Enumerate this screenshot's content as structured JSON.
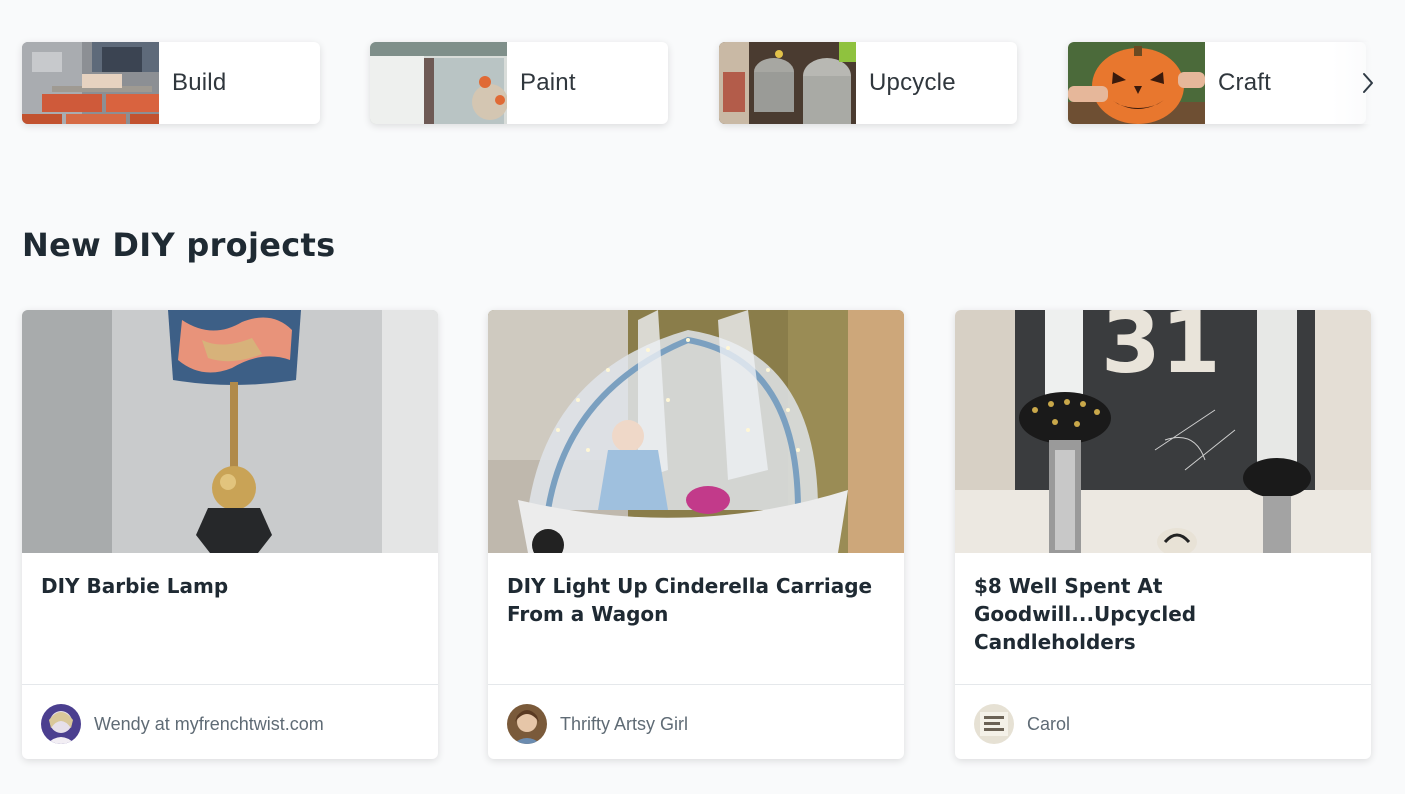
{
  "categories": [
    {
      "label": "Build",
      "icon": "bricklaying-photo"
    },
    {
      "label": "Paint",
      "icon": "paintbrush-photo"
    },
    {
      "label": "Upcycle",
      "icon": "cans-photo"
    },
    {
      "label": "Craft",
      "icon": "pumpkin-carving-photo"
    }
  ],
  "category_next_icon": "chevron-right-icon",
  "section": {
    "title": "New DIY projects"
  },
  "projects": [
    {
      "title": "DIY Barbie Lamp",
      "author": "Wendy at myfrenchtwist.com",
      "image": "barbie-lamp-photo"
    },
    {
      "title": "DIY Light Up Cinderella Carriage From a Wagon",
      "author": "Thrifty Artsy Girl",
      "image": "cinderella-carriage-photo"
    },
    {
      "title": "$8 Well Spent At Goodwill...Upcycled Candleholders",
      "author": "Carol",
      "image": "candleholders-photo",
      "image_text": "31"
    }
  ],
  "colors": {
    "background": "#f9fafb",
    "card": "#ffffff",
    "heading": "#1f2a33",
    "author_text": "#5f6b75",
    "pumpkin": "#e8772e"
  }
}
